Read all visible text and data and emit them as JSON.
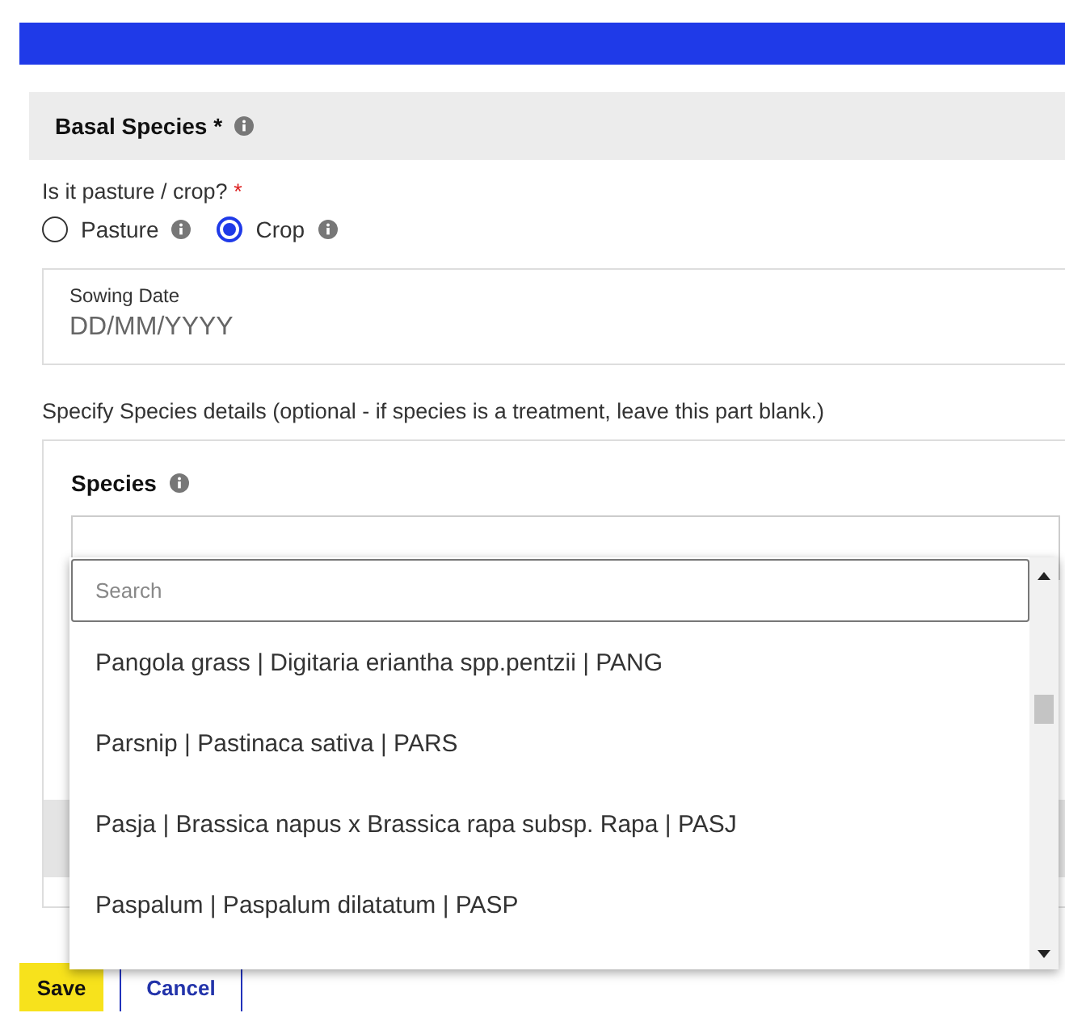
{
  "section": {
    "title": "Basal Species",
    "required_mark": "*"
  },
  "question": {
    "label": "Is it pasture / crop?",
    "required_mark": "*"
  },
  "options": [
    {
      "label": "Pasture",
      "selected": false
    },
    {
      "label": "Crop",
      "selected": true
    }
  ],
  "sowing_date": {
    "label": "Sowing Date",
    "placeholder": "DD/MM/YYYY"
  },
  "hint": "Specify Species details (optional - if species is a treatment, leave this part blank.)",
  "species": {
    "title": "Species"
  },
  "dropdown": {
    "search_placeholder": "Search",
    "options": [
      "Pangola grass | Digitaria eriantha spp.pentzii | PANG",
      "Parsnip | Pastinaca sativa | PARS",
      "Pasja | Brassica napus x Brassica rapa subsp. Rapa | PASJ",
      "Paspalum | Paspalum dilatatum | PASP"
    ]
  },
  "buttons": [
    {
      "label": "Save",
      "kind": "primary"
    },
    {
      "label": "Cancel",
      "kind": "secondary"
    }
  ]
}
